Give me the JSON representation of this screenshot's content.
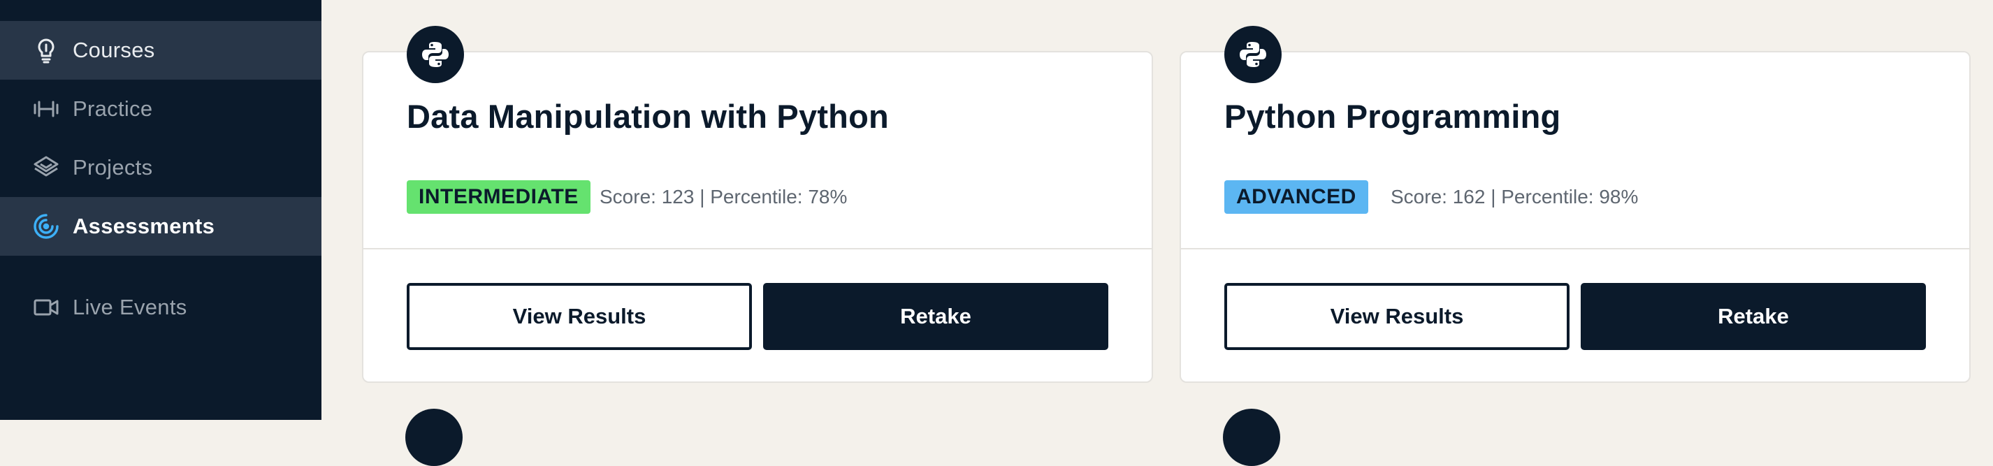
{
  "sidebar": {
    "items": [
      {
        "label": "Courses",
        "icon": "lightbulb-icon"
      },
      {
        "label": "Practice",
        "icon": "dumbbell-icon"
      },
      {
        "label": "Projects",
        "icon": "layers-icon"
      },
      {
        "label": "Assessments",
        "icon": "target-icon"
      },
      {
        "label": "Live Events",
        "icon": "video-camera-icon"
      }
    ]
  },
  "cards": [
    {
      "title": "Data Manipulation with Python",
      "level": "INTERMEDIATE",
      "level_color": "#65e26f",
      "score_text": "Score: 123 | Percentile: 78%",
      "view_label": "View Results",
      "retake_label": "Retake",
      "icon": "python-icon"
    },
    {
      "title": "Python Programming",
      "level": "ADVANCED",
      "level_color": "#5cb6f2",
      "score_text": "Score: 162 | Percentile: 98%",
      "view_label": "View Results",
      "retake_label": "Retake",
      "icon": "python-icon"
    }
  ]
}
